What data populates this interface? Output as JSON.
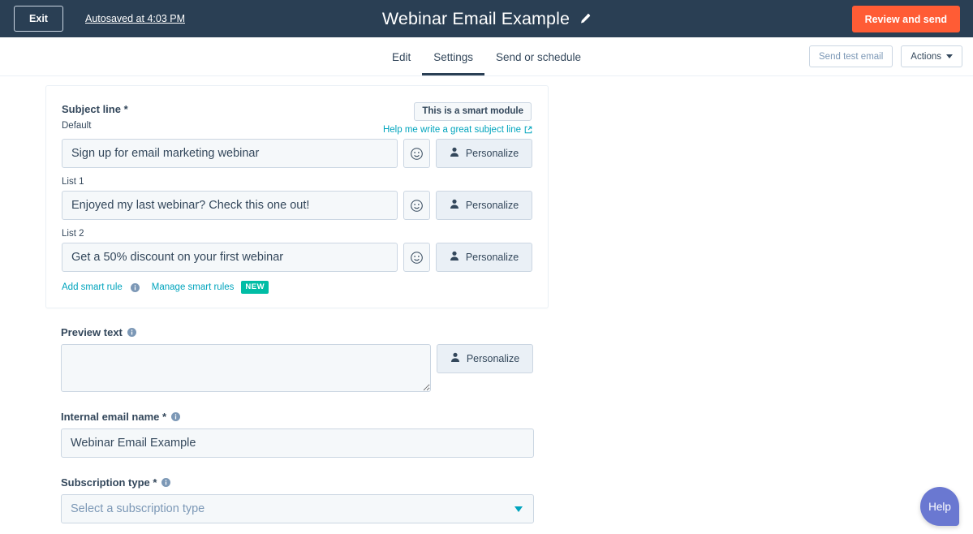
{
  "topbar": {
    "exit_label": "Exit",
    "autosaved_label": "Autosaved at 4:03 PM",
    "doc_title": "Webinar Email Example",
    "edit_title_icon": "pencil-icon",
    "review_label": "Review and send",
    "accent_orange": "#ff5c35",
    "bar_bg": "#2a3f54"
  },
  "tabbar": {
    "tabs": [
      {
        "label": "Edit",
        "active": false
      },
      {
        "label": "Settings",
        "active": true
      },
      {
        "label": "Send or schedule",
        "active": false
      }
    ],
    "send_test_label": "Send test email",
    "actions_label": "Actions"
  },
  "subject_card": {
    "smart_badge_label": "This is a smart module",
    "field_label": "Subject line *",
    "help_link_label": "Help me write a great subject line",
    "help_link_icon": "external-link-icon",
    "rows": [
      {
        "sub_label": "Default",
        "value": "Sign up for email marketing webinar",
        "emoji_icon": "emoji-smiley-icon",
        "personalize_label": "Personalize"
      },
      {
        "sub_label": "List 1",
        "value": "Enjoyed my last webinar? Check this one out!",
        "emoji_icon": "emoji-smiley-icon",
        "personalize_label": "Personalize"
      },
      {
        "sub_label": "List 2",
        "value": "Get a 50% discount on your first webinar",
        "emoji_icon": "emoji-smiley-icon",
        "personalize_label": "Personalize"
      }
    ],
    "add_smart_rule_label": "Add smart rule",
    "manage_smart_rules_label": "Manage smart rules",
    "new_badge_label": "NEW",
    "link_color": "#00a4bd",
    "new_badge_color": "#00bda5"
  },
  "preview": {
    "label": "Preview text",
    "value": "",
    "placeholder": "",
    "personalize_label": "Personalize"
  },
  "internal_name": {
    "label": "Internal email name *",
    "value": "Webinar Email Example"
  },
  "subscription": {
    "label": "Subscription type *",
    "placeholder": "Select a subscription type",
    "selected": "Select a subscription type"
  },
  "help_fab": {
    "label": "Help",
    "color": "#6a78d1"
  }
}
